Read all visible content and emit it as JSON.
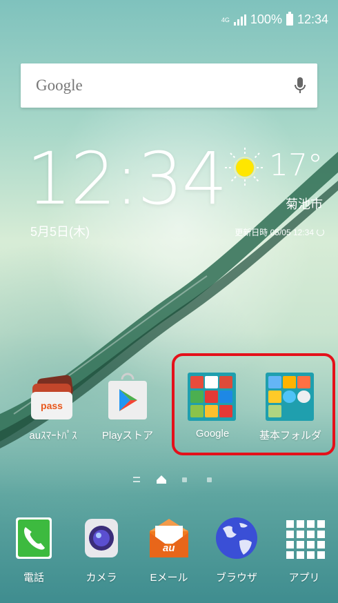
{
  "status_bar": {
    "network": "4G",
    "battery": "100%",
    "time": "12:34"
  },
  "search_widget": {
    "placeholder": "Google",
    "icon": "mic-icon"
  },
  "clock_widget": {
    "time": "12:34",
    "date": "5月5日(木)"
  },
  "weather_widget": {
    "temperature": "17°",
    "city": "菊池市",
    "updated": "更新日時 05/05 12:34",
    "icon": "sun-icon"
  },
  "apps": [
    {
      "label": "auｽﾏｰﾄﾊﾟｽ",
      "icon": "au-smart-pass-icon",
      "icon_text": "pass"
    },
    {
      "label": "Playストア",
      "icon": "play-store-icon"
    },
    {
      "label": "Google",
      "icon": "google-folder-icon"
    },
    {
      "label": "基本フォルダ",
      "icon": "basic-folder-icon"
    }
  ],
  "page_indicator": {
    "pages": 4,
    "active": 1
  },
  "dock": [
    {
      "label": "電話",
      "icon": "phone-icon"
    },
    {
      "label": "カメラ",
      "icon": "camera-icon"
    },
    {
      "label": "Eメール",
      "icon": "email-icon",
      "icon_text": "au"
    },
    {
      "label": "ブラウザ",
      "icon": "browser-icon"
    },
    {
      "label": "アプリ",
      "icon": "apps-grid-icon"
    }
  ],
  "colors": {
    "highlight": "#e4101a",
    "folder": "#1f9fae",
    "phone": "#3dba3f",
    "email": "#f07a1e"
  }
}
